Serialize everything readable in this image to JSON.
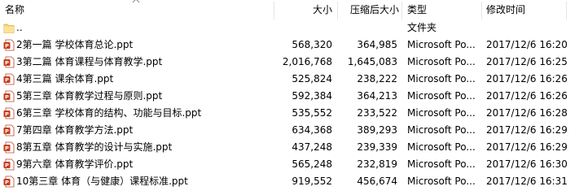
{
  "columns": {
    "name": "名称",
    "size": "大小",
    "compressed": "压缩后大小",
    "type": "类型",
    "modified": "修改时间"
  },
  "parent": {
    "name": "..",
    "type": "文件夹"
  },
  "files": [
    {
      "name": "2第一篇 学校体育总论.ppt",
      "size": "568,320",
      "compressed": "364,985",
      "type": "Microsoft Po...",
      "modified": "2017/12/6 16:20"
    },
    {
      "name": "3第二篇 体育课程与体育教学.ppt",
      "size": "2,016,768",
      "compressed": "1,645,083",
      "type": "Microsoft Po...",
      "modified": "2017/12/6 16:25"
    },
    {
      "name": "4第三篇 课余体育.ppt",
      "size": "525,824",
      "compressed": "238,222",
      "type": "Microsoft Po...",
      "modified": "2017/12/6 16:26"
    },
    {
      "name": "5第三章 体育教学过程与原则.ppt",
      "size": "592,384",
      "compressed": "364,213",
      "type": "Microsoft Po...",
      "modified": "2017/12/6 16:26"
    },
    {
      "name": "6第三章 学校体育的结构、功能与目标.ppt",
      "size": "535,552",
      "compressed": "233,522",
      "type": "Microsoft Po...",
      "modified": "2017/12/6 16:28"
    },
    {
      "name": "7第四章 体育教学方法.ppt",
      "size": "634,368",
      "compressed": "389,293",
      "type": "Microsoft Po...",
      "modified": "2017/12/6 16:29"
    },
    {
      "name": "8第五章  体育教学的设计与实施.ppt",
      "size": "437,248",
      "compressed": "239,339",
      "type": "Microsoft Po...",
      "modified": "2017/12/6 16:29"
    },
    {
      "name": "9第六章 体育教学评价.ppt",
      "size": "565,248",
      "compressed": "232,819",
      "type": "Microsoft Po...",
      "modified": "2017/12/6 16:30"
    },
    {
      "name": "10第三章  体育（与健康）课程标准.ppt",
      "size": "919,552",
      "compressed": "456,674",
      "type": "Microsoft Po...",
      "modified": "2017/12/6 16:31"
    }
  ],
  "colors": {
    "ppt_icon": "#c43e1c",
    "folder_icon": "#f8d775",
    "header_separator": "#e5e5e5"
  },
  "icons": {
    "sort": "sort-ascending-icon",
    "folder": "folder-icon",
    "file": "powerpoint-file-icon"
  }
}
